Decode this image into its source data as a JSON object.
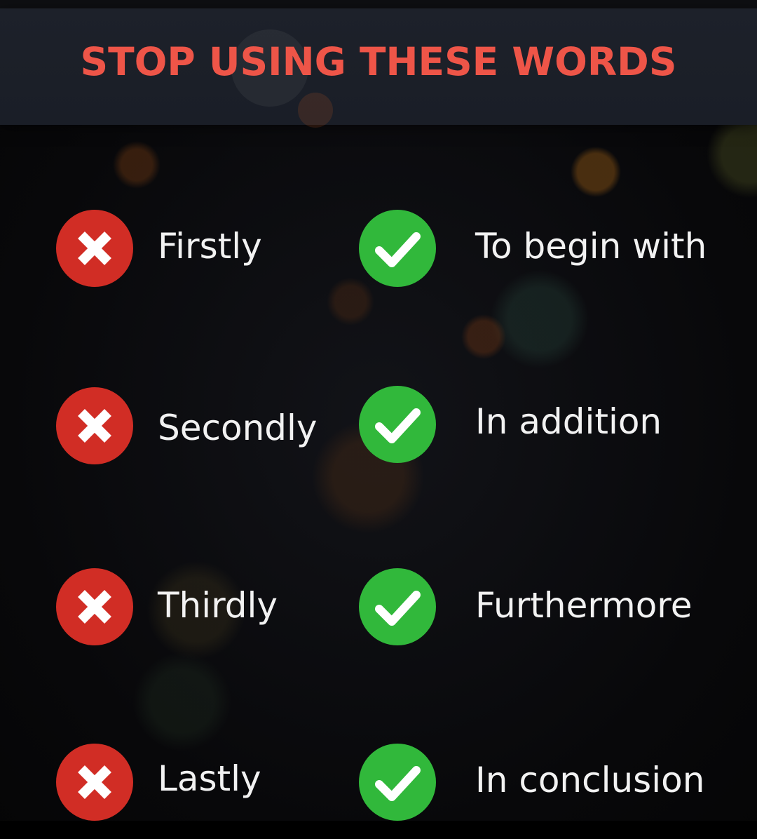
{
  "header": {
    "title": "STOP USING THESE WORDS"
  },
  "colors": {
    "title": "#ee5548",
    "banner": "#1c2029",
    "bad_icon": "#d12d25",
    "good_icon": "#31b83b",
    "text": "#f2f2f2"
  },
  "icons": {
    "bad": "x-cross-icon",
    "good": "check-mark-icon"
  },
  "rows": [
    {
      "avoid": "Firstly",
      "use": "To begin with"
    },
    {
      "avoid": "Secondly",
      "use": "In addition"
    },
    {
      "avoid": "Thirdly",
      "use": "Furthermore"
    },
    {
      "avoid": "Lastly",
      "use": "In conclusion"
    }
  ]
}
